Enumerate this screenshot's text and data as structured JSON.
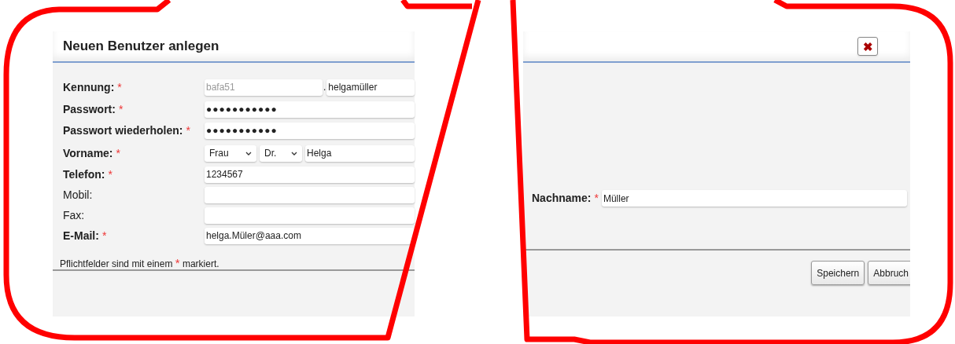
{
  "dialog": {
    "title": "Neuen Benutzer anlegen",
    "close_label": "✖"
  },
  "fields": [
    {
      "kind": "login",
      "label": "Kennung:",
      "required": true,
      "prefix": "bafa51",
      "separator": ".",
      "value": "helgamüller"
    },
    {
      "kind": "password",
      "label": "Passwort:",
      "required": true,
      "value": "●●●●●●●●●●●"
    },
    {
      "kind": "password",
      "label": "Passwort wiederholen:",
      "required": true,
      "value": "●●●●●●●●●●●"
    },
    {
      "kind": "name",
      "label": "Vorname:",
      "required": true,
      "salutation": "Frau",
      "degree": "Dr.",
      "value": "Helga"
    },
    {
      "kind": "text",
      "label": "Telefon:",
      "required": true,
      "value": "1234567"
    },
    {
      "kind": "text",
      "label": "Mobil:",
      "required": false
    },
    {
      "kind": "text",
      "label": "Fax:",
      "required": false
    },
    {
      "kind": "text",
      "label": "E-Mail:",
      "required": true,
      "value": "helga.Müler@aaa.com"
    }
  ],
  "required_mark": "*",
  "note": {
    "before": "Pflichtfelder sind mit einem",
    "mark": "*",
    "after": "markiert."
  },
  "right_field": {
    "label": "Nachname:",
    "required": true,
    "value": "Müller"
  },
  "buttons": [
    "Speichern",
    "Abbruch"
  ]
}
